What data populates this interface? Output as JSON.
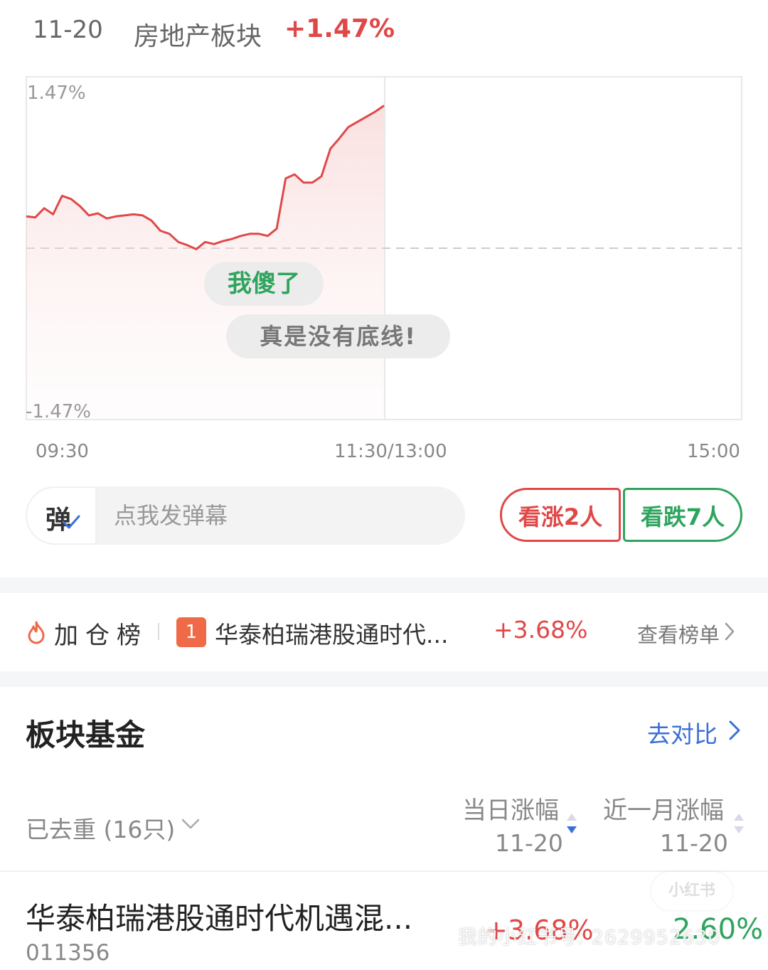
{
  "header": {
    "date": "11-20",
    "sector_name": "房地产板块",
    "change": "+1.47%"
  },
  "chart_data": {
    "type": "line",
    "title": "",
    "y_axis_labels": [
      "1.47%",
      "-1.47%"
    ],
    "ylim": [
      -1.47,
      1.47
    ],
    "baseline": 0,
    "x_ticks": [
      "09:30",
      "11:30/13:00",
      "15:00"
    ],
    "xlim": [
      0,
      240
    ],
    "grid": "dashed zero line, vertical divider at 11:30/13:00",
    "series": [
      {
        "color": "#e04848",
        "x": [
          0,
          3,
          6,
          9,
          12,
          15,
          18,
          21,
          24,
          27,
          30,
          33,
          36,
          39,
          42,
          45,
          48,
          51,
          54,
          57,
          60,
          63,
          66,
          69,
          72,
          75,
          78,
          81,
          84,
          87,
          90,
          93,
          96,
          99,
          102,
          105,
          108,
          111,
          114,
          117,
          120
        ],
        "values": [
          0.31,
          0.3,
          0.39,
          0.33,
          0.51,
          0.48,
          0.41,
          0.32,
          0.34,
          0.29,
          0.31,
          0.32,
          0.33,
          0.32,
          0.27,
          0.17,
          0.14,
          0.06,
          0.03,
          -0.01,
          0.06,
          0.04,
          0.07,
          0.09,
          0.12,
          0.14,
          0.14,
          0.12,
          0.19,
          0.68,
          0.72,
          0.64,
          0.64,
          0.7,
          0.97,
          1.07,
          1.18,
          1.23,
          1.28,
          1.33,
          1.39
        ]
      }
    ]
  },
  "danmaku": {
    "bubbles": [
      "我傻了",
      "真是没有底线!"
    ],
    "icon_label": "弹",
    "input_placeholder": "点我发弹幕",
    "bull_vote": "看涨2人",
    "bear_vote": "看跌7人"
  },
  "leaderboard": {
    "title": "加仓榜",
    "rank": "1",
    "fund_name": "华泰柏瑞港股通时代...",
    "change": "+3.68%",
    "more": "查看榜单"
  },
  "sector_funds": {
    "title": "板块基金",
    "compare": "去对比",
    "dedup_label": "已去重 (16只)",
    "col_day": "当日涨幅",
    "col_day_date": "11-20",
    "col_month": "近一月涨幅",
    "col_month_date": "11-20",
    "rows": [
      {
        "name": "华泰柏瑞港股通时代机遇混...",
        "code": "011356",
        "day_change": "+3.68%",
        "month_change": "2.60%"
      }
    ]
  },
  "watermark": {
    "text": "我的小红书号: 2629952630",
    "logo": "小红书"
  },
  "colors": {
    "up": "#e04848",
    "down": "#2fa45e",
    "link": "#3a6fd8"
  }
}
